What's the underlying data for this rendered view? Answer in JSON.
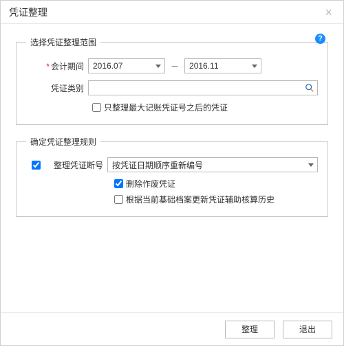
{
  "title": "凭证整理",
  "help_icon": "?",
  "group_scope": {
    "legend": "选择凭证整理范围",
    "period_label": "会计期间",
    "period_from": "2016.07",
    "period_sep": "－",
    "period_to": "2016.11",
    "type_label": "凭证类别",
    "type_value": "",
    "only_after_max_label": "只整理最大记账凭证号之后的凭证",
    "only_after_max_checked": false
  },
  "group_rule": {
    "legend": "确定凭证整理规则",
    "reseq_enabled": true,
    "reseq_label": "整理凭证断号",
    "reseq_mode": "按凭证日期顺序重新编号",
    "del_void_label": "删除作废凭证",
    "del_void_checked": true,
    "refresh_aux_label": "根据当前基础档案更新凭证辅助核算历史",
    "refresh_aux_checked": false
  },
  "footer": {
    "ok": "整理",
    "cancel": "退出"
  }
}
